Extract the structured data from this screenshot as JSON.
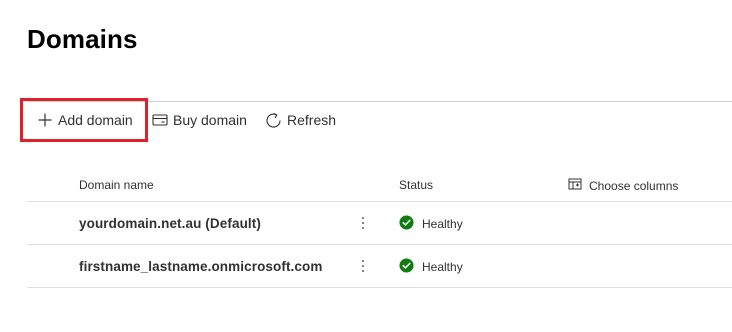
{
  "page": {
    "title": "Domains"
  },
  "toolbar": {
    "add_label": "Add domain",
    "buy_label": "Buy domain",
    "refresh_label": "Refresh"
  },
  "grid": {
    "columns": {
      "domain_name": "Domain name",
      "status": "Status"
    },
    "choose_columns_label": "Choose columns",
    "rows": [
      {
        "domain": "yourdomain.net.au (Default)",
        "status": "Healthy"
      },
      {
        "domain": "firstname_lastname.onmicrosoft.com",
        "status": "Healthy"
      }
    ]
  },
  "colors": {
    "highlight_border": "#e0202a",
    "status_healthy": "#107c10",
    "divider": "#e1dfdd"
  },
  "icons": {
    "add": "plus-icon",
    "buy": "credit-card-icon",
    "refresh": "refresh-icon",
    "choose_columns": "column-options-icon",
    "more": "more-vertical-icon",
    "healthy": "checkmark-circle-icon"
  }
}
